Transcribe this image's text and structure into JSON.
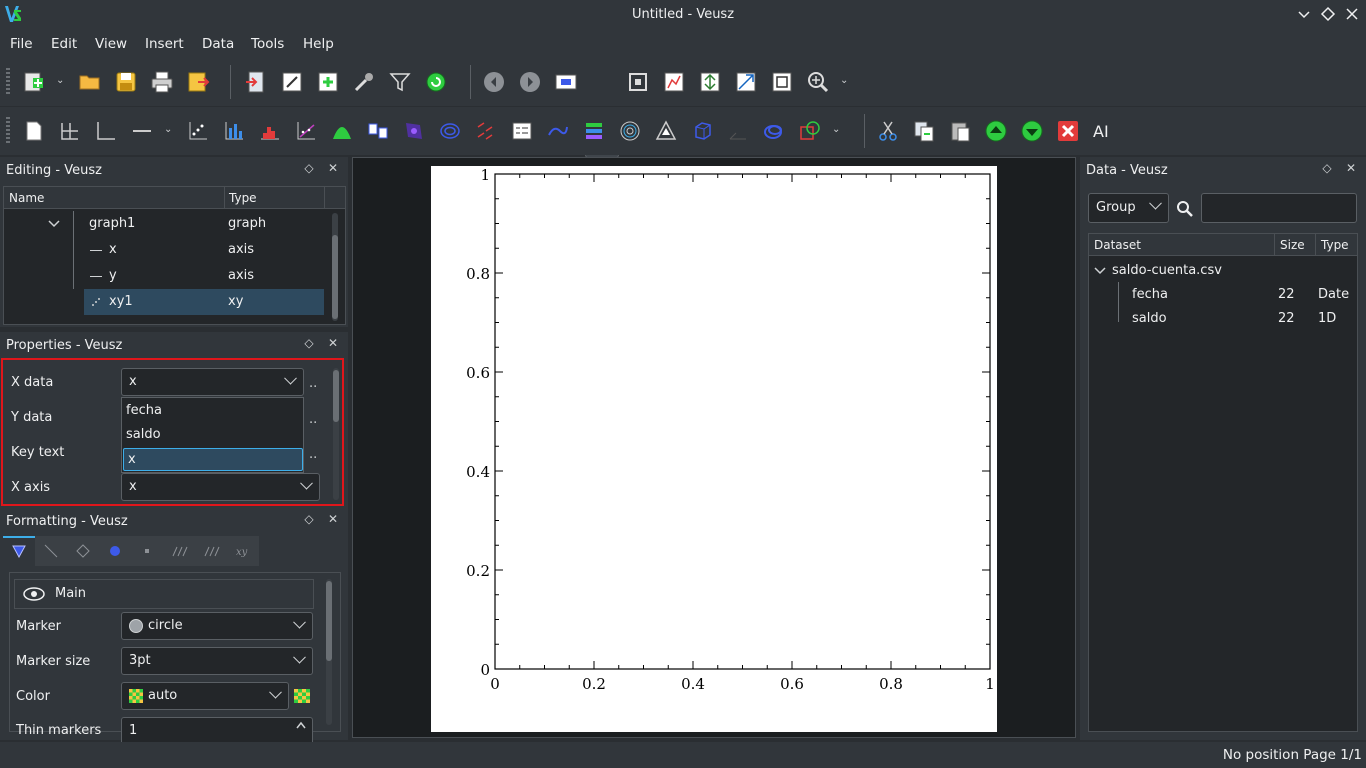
{
  "window": {
    "title": "Untitled - Veusz"
  },
  "menu": [
    "File",
    "Edit",
    "View",
    "Insert",
    "Data",
    "Tools",
    "Help"
  ],
  "editing_panel": {
    "title": "Editing - Veusz",
    "columns": [
      "Name",
      "Type"
    ],
    "rows": [
      {
        "name": "graph1",
        "type": "graph"
      },
      {
        "name": "x",
        "type": "axis"
      },
      {
        "name": "y",
        "type": "axis"
      },
      {
        "name": "xy1",
        "type": "xy"
      }
    ]
  },
  "properties_panel": {
    "title": "Properties - Veusz",
    "x_data_label": "X data",
    "x_data_value": "x",
    "y_data_label": "Y data",
    "key_text_label": "Key text",
    "x_axis_label": "X axis",
    "x_axis_value": "x",
    "dots": "..",
    "dropdown_options": [
      "fecha",
      "saldo",
      "x"
    ]
  },
  "formatting_panel": {
    "title": "Formatting - Veusz",
    "section": "Main",
    "marker_label": "Marker",
    "marker_value": "circle",
    "marker_size_label": "Marker size",
    "marker_size_value": "3pt",
    "color_label": "Color",
    "color_value": "auto",
    "thin_markers_label": "Thin markers",
    "thin_markers_value": "1"
  },
  "plot": {
    "x_ticks": [
      "0",
      "0.2",
      "0.4",
      "0.6",
      "0.8",
      "1"
    ],
    "y_ticks": [
      "0",
      "0.2",
      "0.4",
      "0.6",
      "0.8",
      "1"
    ]
  },
  "data_panel": {
    "title": "Data - Veusz",
    "group_value": "Group",
    "search_placeholder": "",
    "columns": [
      "Dataset",
      "Size",
      "Type"
    ],
    "file": "saldo-cuenta.csv",
    "datasets": [
      {
        "name": "fecha",
        "size": "22",
        "type": "Date"
      },
      {
        "name": "saldo",
        "size": "22",
        "type": "1D"
      }
    ]
  },
  "status": {
    "text": "No position  Page 1/1"
  },
  "colors": {
    "accent": "#3daee9",
    "highlight_border": "#e0161b",
    "selection": "#2e4a5f"
  }
}
